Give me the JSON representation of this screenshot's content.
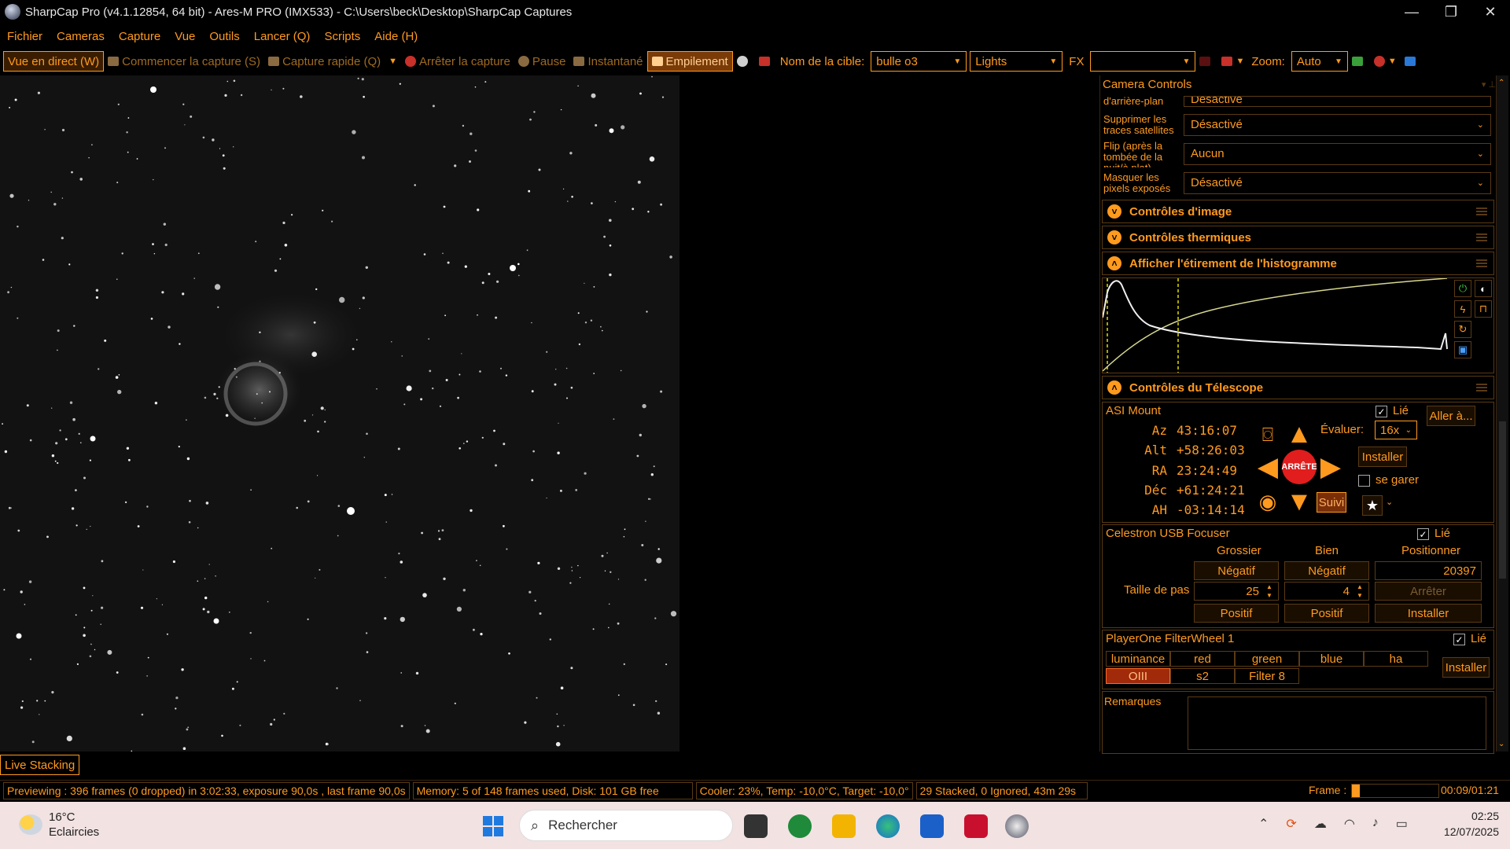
{
  "window": {
    "title": "SharpCap Pro (v4.1.12854, 64 bit) - Ares-M PRO (IMX533) - C:\\Users\\beck\\Desktop\\SharpCap Captures",
    "minimize": "—",
    "maximize": "❐",
    "close": "✕"
  },
  "menu": [
    "Fichier",
    "Cameras",
    "Capture",
    "Vue",
    "Outils",
    "Lancer (Q)",
    "Scripts",
    "Aide (H)"
  ],
  "toolbar": {
    "live_view": "Vue en direct (W)",
    "start_capture": "Commencer la capture (S)",
    "quick_capture": "Capture rapide (Q)",
    "stop_capture": "Arrêter la capture",
    "pause": "Pause",
    "snapshot": "Instantané",
    "stacking": "Empilement",
    "target_label": "Nom de la cible:",
    "target_value": "bulle o3",
    "frame_type": "Lights",
    "fx_label": "FX",
    "fx_value": "",
    "zoom_label": "Zoom:",
    "zoom_value": "Auto"
  },
  "panel": {
    "title": "Camera Controls",
    "props": [
      {
        "label": "d'arrière-plan",
        "value": "Désactivé"
      },
      {
        "label": "Supprimer les traces satellites",
        "value": "Désactivé"
      },
      {
        "label": "Flip (après la tombée de la nuit/à plat)",
        "value": "Aucun"
      },
      {
        "label": "Masquer les pixels exposés",
        "value": "Désactivé"
      }
    ],
    "sections": {
      "image": "Contrôles d'image",
      "thermal": "Contrôles thermiques",
      "histogram": "Afficher l'étirement de l'histogramme",
      "telescope": "Contrôles du Télescope"
    }
  },
  "mount": {
    "name": "ASI Mount",
    "linked_label": "Lié",
    "goto": "Aller à...",
    "rate_label": "Évaluer:",
    "rate_value": "16x",
    "setup": "Installer",
    "park_label": "se garer",
    "tracking": "Suivi",
    "stop": "ARRÊTE",
    "coords": [
      {
        "label": "Az",
        "value": "43:16:07"
      },
      {
        "label": "Alt",
        "value": "+58:26:03"
      },
      {
        "label": "RA",
        "value": "23:24:49"
      },
      {
        "label": "Déc",
        "value": "+61:24:21"
      },
      {
        "label": "AH",
        "value": "-03:14:14"
      }
    ]
  },
  "focuser": {
    "name": "Celestron USB Focuser",
    "linked_label": "Lié",
    "col_coarse": "Grossier",
    "col_fine": "Bien",
    "col_position": "Positionner",
    "negative": "Négatif",
    "positive": "Positif",
    "position": "20397",
    "step_label": "Taille de pas",
    "coarse_step": "25",
    "fine_step": "4",
    "stop": "Arrêter",
    "setup": "Installer"
  },
  "filterwheel": {
    "name": "PlayerOne FilterWheel 1",
    "linked_label": "Lié",
    "filters": [
      "luminance",
      "red",
      "green",
      "blue",
      "ha",
      "OIII",
      "s2",
      "Filter 8"
    ],
    "selected": "OIII",
    "setup": "Installer"
  },
  "notes_label": "Remarques",
  "live_stacking_tab": "Live Stacking",
  "status": {
    "preview": "Previewing : 396 frames (0 dropped) in 3:02:33, exposure 90,0s , last frame 90,0s",
    "memory": "Memory: 5 of 148 frames used, Disk: 101 GB free",
    "cooler": "Cooler: 23%, Temp: -10,0°C, Target: -10,0°",
    "stacked": "29 Stacked, 0 Ignored, 43m 29s",
    "frame_label": "Frame :",
    "frame_progress": 0.09,
    "frame_time": "00:09/01:21"
  },
  "taskbar": {
    "temperature": "16°C",
    "weather": "Eclaircies",
    "search_placeholder": "Rechercher",
    "time": "02:25",
    "date": "12/07/2025"
  },
  "colors": {
    "accent": "#ff9a1f",
    "background": "#000000",
    "stop_red": "#e11d1d",
    "selected_filter": "#a02a0a"
  }
}
